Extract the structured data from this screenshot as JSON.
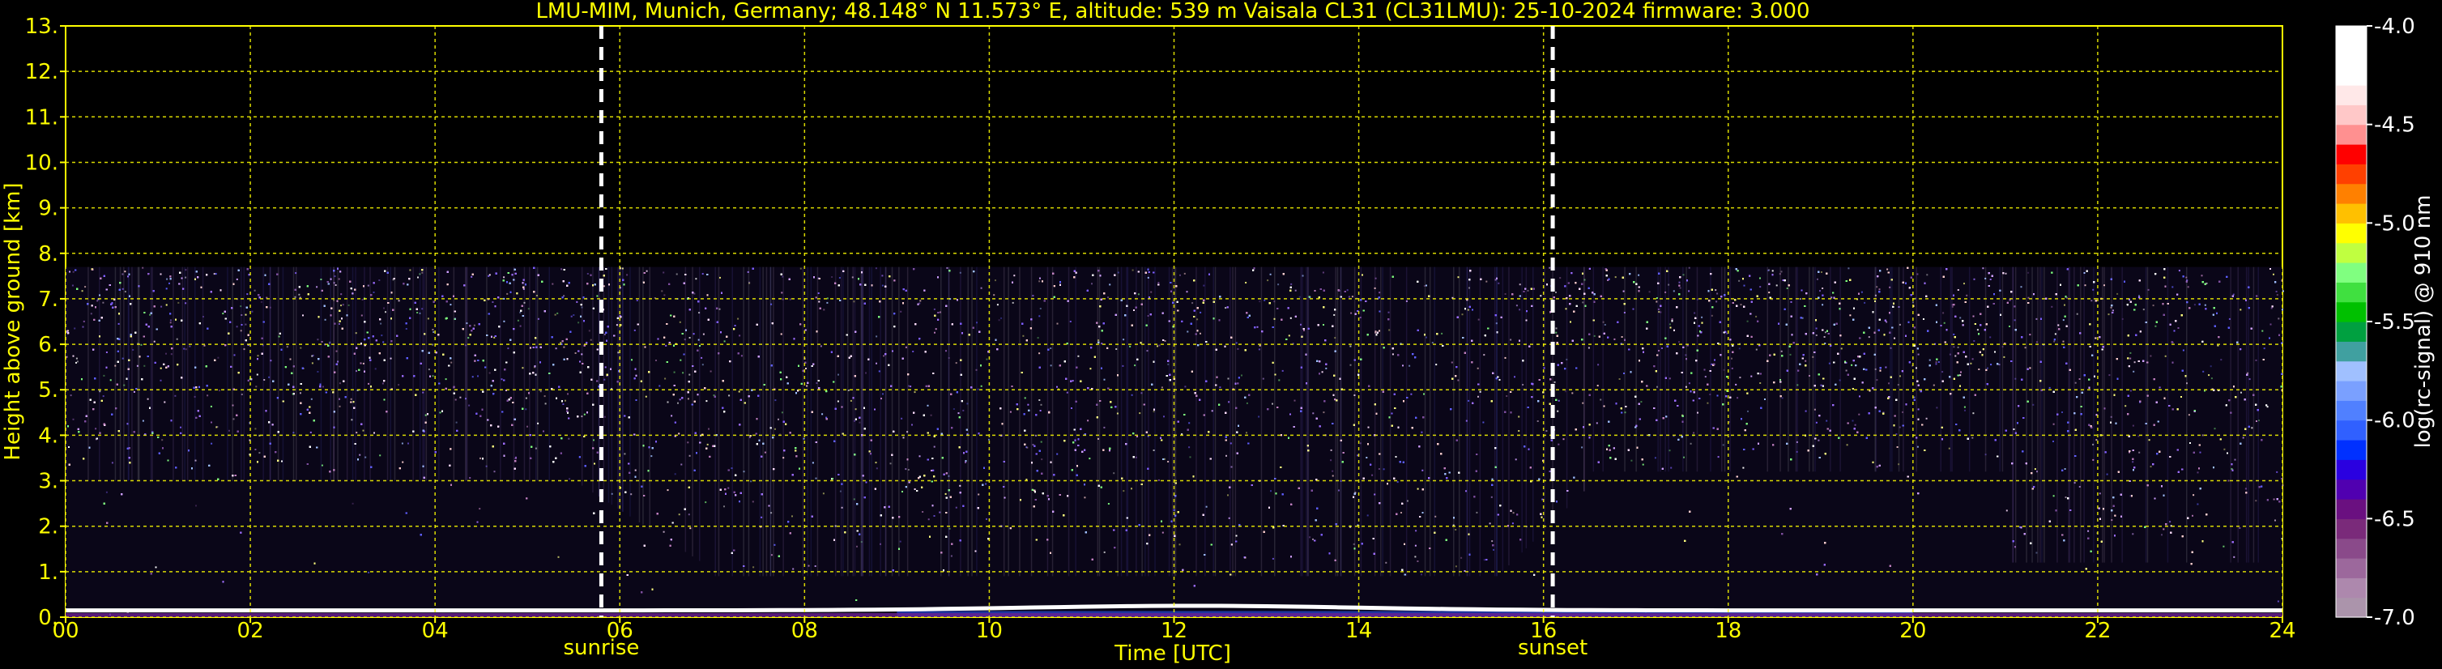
{
  "chart_data": {
    "type": "heatmap",
    "title": "LMU-MIM, Munich, Germany; 48.148° N 11.573° E, altitude: 539 m    Vaisala CL31 (CL31LMU): 25-10-2024    firmware: 3.000",
    "xlabel": "Time [UTC]",
    "ylabel": "Height above ground [km]",
    "xlim": [
      0,
      24
    ],
    "ylim": [
      0,
      13
    ],
    "x_ticks": [
      "00",
      "02",
      "04",
      "06",
      "08",
      "10",
      "12",
      "14",
      "16",
      "18",
      "20",
      "22",
      "24"
    ],
    "y_ticks": [
      "0.",
      "1.",
      "2.",
      "3.",
      "4.",
      "5.",
      "6.",
      "7.",
      "8.",
      "9.",
      "10.",
      "11.",
      "12.",
      "13."
    ],
    "grid": true,
    "data_top_km": 7.7,
    "surface_layer_km": 0.15,
    "events": [
      {
        "label": "sunrise",
        "time_utc": 5.8
      },
      {
        "label": "sunset",
        "time_utc": 16.1
      }
    ],
    "colorbar": {
      "label": "log(rc-signal) @ 910 nm",
      "ticks": [
        "-4.0",
        "-4.5",
        "-5.0",
        "-5.5",
        "-6.0",
        "-6.5",
        "-7.0"
      ],
      "range": [
        -7.0,
        -4.0
      ],
      "colors": [
        "#ab94ab",
        "#ad88ad",
        "#9c689c",
        "#8a4a8a",
        "#7a2a7a",
        "#6a1080",
        "#5000b0",
        "#2a00e0",
        "#0030ff",
        "#3060ff",
        "#5080ff",
        "#7aa0ff",
        "#a0c0ff",
        "#40a0a0",
        "#00a040",
        "#00c000",
        "#40e040",
        "#80ff80",
        "#c0ff40",
        "#ffff00",
        "#ffc000",
        "#ff8000",
        "#ff4000",
        "#ff0000",
        "#ff9090",
        "#ffc8c8",
        "#ffe8e8",
        "#ffffff",
        "#ffffff",
        "#ffffff"
      ]
    }
  }
}
